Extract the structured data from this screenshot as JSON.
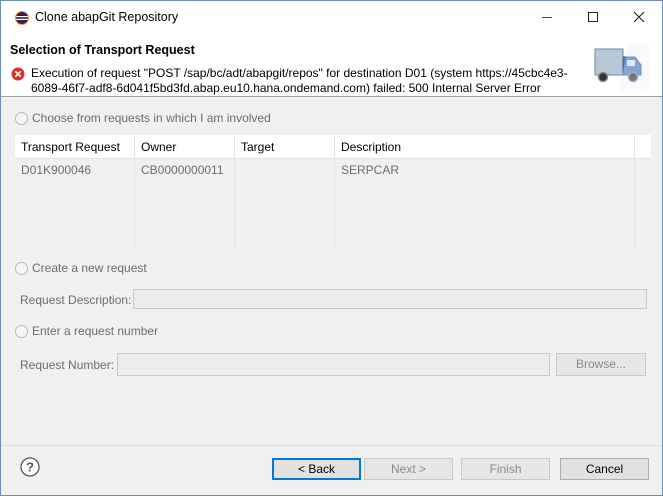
{
  "window": {
    "title": "Clone abapGit Repository"
  },
  "banner": {
    "title": "Selection of Transport Request",
    "error_line1": "Execution of request \"POST /sap/bc/adt/abapgit/repos\" for destination D01 (system https://45cbc4e3-",
    "error_line2": "6089-46f7-adf8-6d041f5bd3fd.abap.eu10.hana.ondemand.com) failed: 500 Internal Server Error"
  },
  "options": {
    "choose_label": "Choose from requests in which I am involved",
    "create_label": "Create a new request",
    "enter_label": "Enter a request number"
  },
  "table": {
    "columns": [
      "Transport Request",
      "Owner",
      "Target",
      "Description"
    ],
    "rows": [
      {
        "request": "D01K900046",
        "owner": "CB0000000011",
        "target": "",
        "description": "SERPCAR"
      }
    ]
  },
  "fields": {
    "request_description_label": "Request Description:",
    "request_number_label": "Request Number:",
    "browse_label": "Browse..."
  },
  "footer": {
    "back_label": "< Back",
    "next_label": "Next >",
    "finish_label": "Finish",
    "cancel_label": "Cancel"
  },
  "colors": {
    "error_red": "#d9322b",
    "accent_blue": "#0078d7",
    "disabled_text": "#6d6d6d"
  },
  "icons": [
    "eclipse-app-icon",
    "minimize-icon",
    "maximize-icon",
    "close-icon",
    "error-icon",
    "transport-truck-icon",
    "help-icon"
  ]
}
